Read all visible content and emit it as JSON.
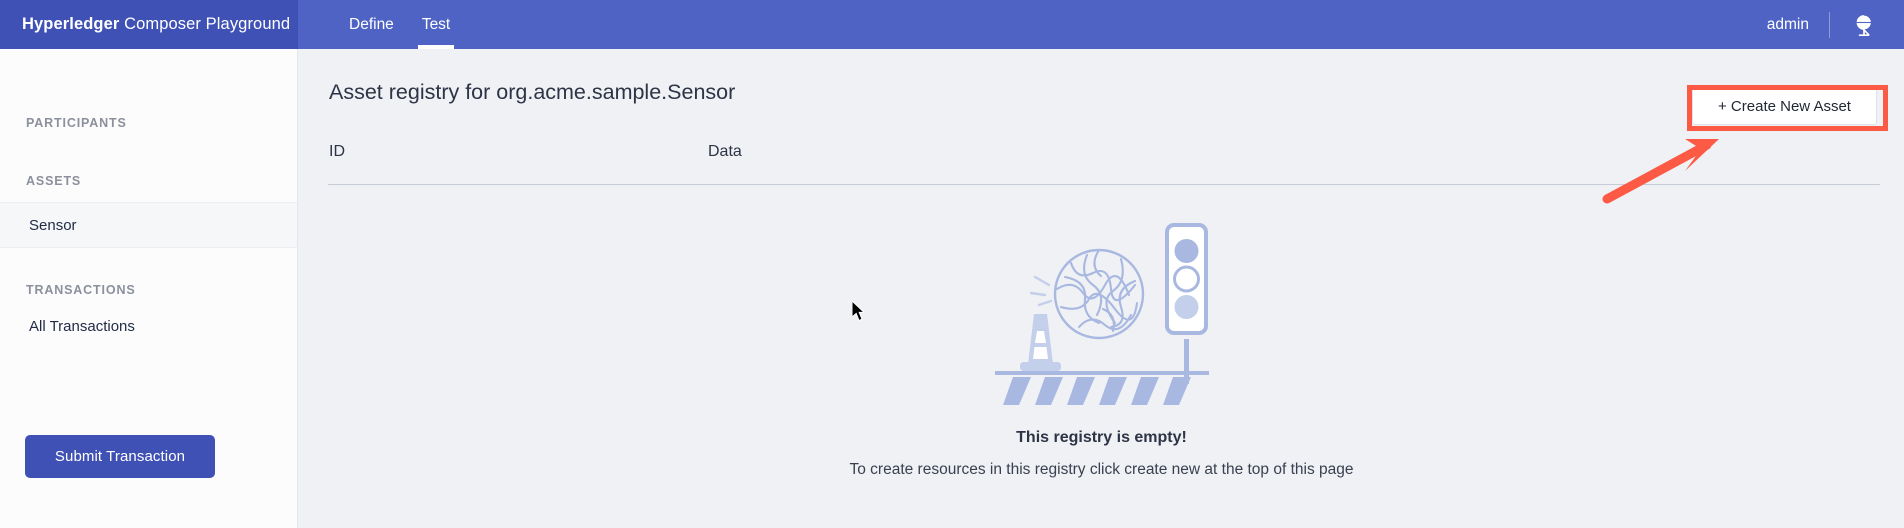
{
  "header": {
    "brand_strong": "Hyperledger",
    "brand_light": " Composer Playground",
    "tabs": [
      {
        "label": "Define",
        "active": false
      },
      {
        "label": "Test",
        "active": true
      }
    ],
    "user": "admin",
    "globe_icon": "globe-icon"
  },
  "sidebar": {
    "sections": [
      {
        "label": "PARTICIPANTS"
      },
      {
        "label": "ASSETS"
      },
      {
        "label": "TRANSACTIONS"
      }
    ],
    "assets": [
      {
        "label": "Sensor",
        "selected": true
      }
    ],
    "transactions": [
      {
        "label": "All Transactions",
        "selected": false
      }
    ],
    "submit_button": "Submit Transaction"
  },
  "main": {
    "title": "Asset registry for org.acme.sample.Sensor",
    "create_button": "+ Create New Asset",
    "table": {
      "columns": [
        "ID",
        "Data"
      ],
      "rows": []
    },
    "empty_state": {
      "title": "This registry is empty!",
      "subtitle": "To create resources in this registry click create new at the top of this page",
      "illustration": "empty-registry-illustration"
    }
  },
  "annotation": {
    "color": "#fc5a45",
    "target": "+ Create New Asset"
  },
  "colors": {
    "brand_dark": "#3f51b5",
    "brand": "#4e63c4",
    "page_background": "#eff1f5",
    "sidebar_background": "#fcfcfd",
    "illustration": "#a8b8e0",
    "annotation_red": "#fc5a45"
  }
}
